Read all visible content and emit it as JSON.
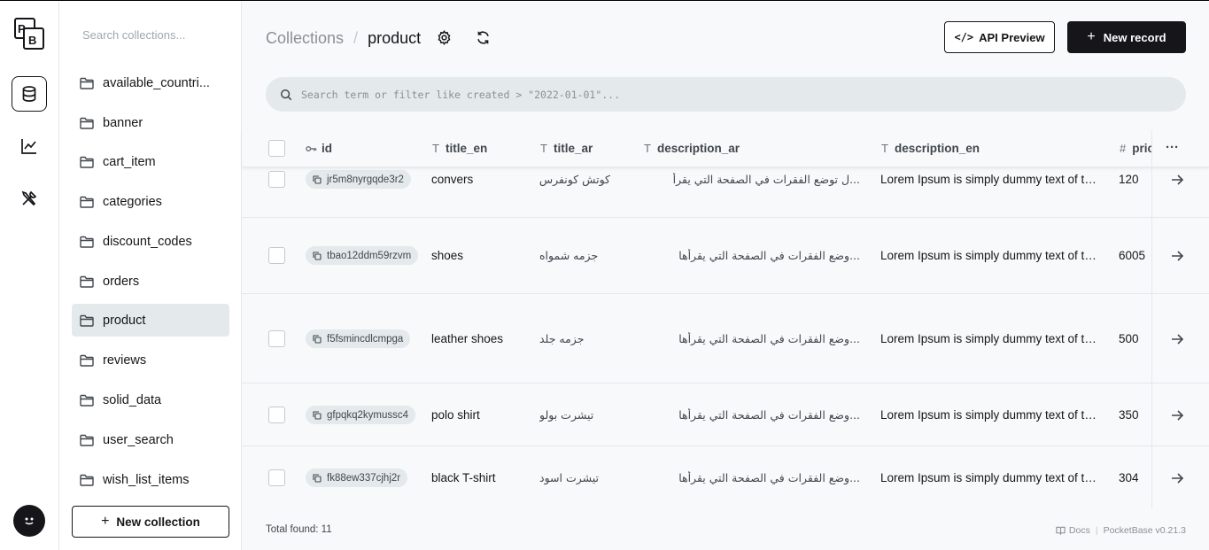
{
  "rail": {
    "logo_text": "PB",
    "items": [
      "collections-icon",
      "logs-icon",
      "settings-icon"
    ]
  },
  "sidebar": {
    "search_placeholder": "Search collections...",
    "collections": [
      "available_countri...",
      "banner",
      "cart_item",
      "categories",
      "discount_codes",
      "orders",
      "product",
      "reviews",
      "solid_data",
      "user_search",
      "wish_list_items"
    ],
    "active": "product",
    "new_collection_label": "New collection"
  },
  "header": {
    "breadcrumb_root": "Collections",
    "breadcrumb_separator": "/",
    "breadcrumb_current": "product",
    "api_preview_label": "API Preview",
    "api_preview_symbol": "</>",
    "new_record_label": "New record",
    "search_placeholder": "Search term or filter like created > \"2022-01-01\"..."
  },
  "table": {
    "columns": {
      "id": "id",
      "title_en": "title_en",
      "title_ar": "title_ar",
      "description_ar": "description_ar",
      "description_en": "description_en",
      "price": "pric",
      "more": "···"
    },
    "column_type_glyphs": {
      "text": "T",
      "number": "#",
      "key": "o⊸"
    },
    "rows": [
      {
        "id": "jr5m8nyrgqde3r2",
        "title_en": "convers",
        "title_ar": "كوتش كونفرس",
        "description_ar": "...ل توضع الفقرات في الصفحة التي يقرأ",
        "description_en": "Lorem Ipsum is simply dummy text of the pr...",
        "price": "120"
      },
      {
        "id": "tbao12ddm59rzvm",
        "title_en": "shoes",
        "title_ar": "جزمه شمواه",
        "description_ar": "...وضع الفقرات في الصفحة التي يقرأها",
        "description_en": "Lorem Ipsum is simply dummy text of the pr...",
        "price": "6005"
      },
      {
        "id": "f5fsmincdlcmpga",
        "title_en": "leather shoes",
        "title_ar": "جزمه جلد",
        "description_ar": "...وضع الفقرات في الصفحة التي يقرأها",
        "description_en": "Lorem Ipsum is simply dummy text of the pr...",
        "price": "500"
      },
      {
        "id": "gfpqkq2kymussc4",
        "title_en": "polo shirt",
        "title_ar": "تيشرت بولو",
        "description_ar": "...وضع الفقرات في الصفحة التي يقرأها",
        "description_en": "Lorem Ipsum is simply dummy text of the pr...",
        "price": "350"
      },
      {
        "id": "fk88ew337cjhj2r",
        "title_en": "black T-shirt",
        "title_ar": "تيشرت اسود",
        "description_ar": "...وضع الفقرات في الصفحة التي يقرأها",
        "description_en": "Lorem Ipsum is simply dummy text of the pr...",
        "price": "304"
      }
    ]
  },
  "footer": {
    "total_label": "Total found:",
    "total_count": "11",
    "docs_label": "Docs",
    "separator": "|",
    "version_label": "PocketBase v0.21.3"
  },
  "colors": {
    "primary": "#16161a",
    "surface": "#f8f9fa",
    "muted_bg": "#e4e9ec",
    "muted_text": "#8a9096"
  }
}
